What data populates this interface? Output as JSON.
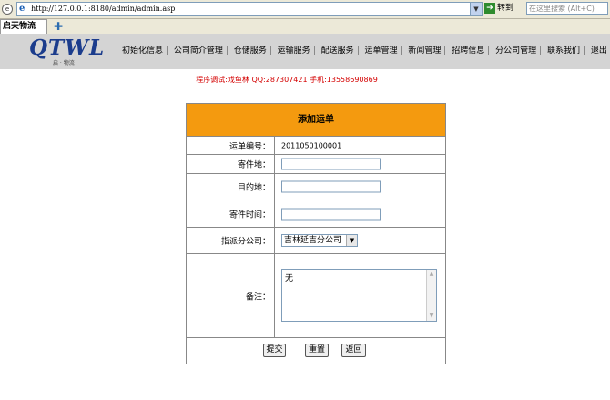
{
  "browser": {
    "url": "http://127.0.0.1:8180/admin/admin.asp",
    "go_label": "转到",
    "search_placeholder": "在这里搜索 (Alt+C)",
    "tab_label": "启天物流"
  },
  "header": {
    "logo_text": "QTWL",
    "logo_sub": "启 · 物流",
    "nav": [
      "初始化信息",
      "公司简介管理",
      "仓储服务",
      "运输服务",
      "配送服务",
      "运单管理",
      "新闻管理",
      "招聘信息",
      "分公司管理",
      "联系我们",
      "退出"
    ]
  },
  "debug_text": "程序调试:戏鱼林 QQ:287307421 手机:13558690869",
  "form": {
    "title": "添加运单",
    "order_no_label": "运单编号：",
    "order_no_value": "2011050100001",
    "from_label": "寄件地：",
    "from_value": "",
    "to_label": "目的地：",
    "to_value": "",
    "send_time_label": "寄件时间：",
    "send_time_value": "",
    "branch_label": "指派分公司：",
    "branch_value": "吉林延吉分公司",
    "remark_label": "备注：",
    "remark_value": "无",
    "submit_label": "提交",
    "reset_label": "重置",
    "back_label": "返回"
  }
}
